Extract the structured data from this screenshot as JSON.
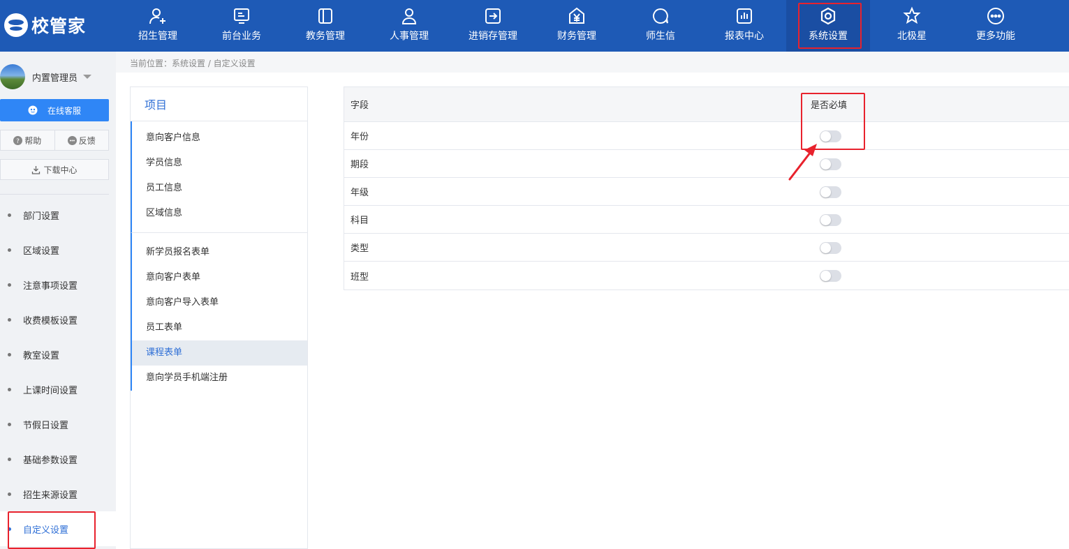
{
  "brand": {
    "logo_text": "校管家"
  },
  "nav": {
    "items": [
      {
        "label": "招生管理",
        "icon": "add-user-icon"
      },
      {
        "label": "前台业务",
        "icon": "monitor-icon"
      },
      {
        "label": "教务管理",
        "icon": "book-icon"
      },
      {
        "label": "人事管理",
        "icon": "person-icon"
      },
      {
        "label": "进销存管理",
        "icon": "exchange-icon"
      },
      {
        "label": "财务管理",
        "icon": "yen-icon"
      },
      {
        "label": "师生信",
        "icon": "chat-icon"
      },
      {
        "label": "报表中心",
        "icon": "report-icon"
      },
      {
        "label": "系统设置",
        "icon": "gear-icon"
      },
      {
        "label": "北极星",
        "icon": "star-icon"
      },
      {
        "label": "更多功能",
        "icon": "more-icon"
      }
    ],
    "active": "系统设置"
  },
  "user": {
    "name": "内置管理员"
  },
  "sidebar": {
    "online_service": "在线客服",
    "help": "帮助",
    "feedback": "反馈",
    "download_center": "下载中心",
    "menu": [
      "部门设置",
      "区域设置",
      "注意事项设置",
      "收费模板设置",
      "教室设置",
      "上课时间设置",
      "节假日设置",
      "基础参数设置",
      "招生来源设置",
      "自定义设置"
    ],
    "active_menu": "自定义设置"
  },
  "breadcrumb": "当前位置：系统设置 / 自定义设置",
  "project_panel": {
    "title": "项目",
    "group1": [
      "意向客户信息",
      "学员信息",
      "员工信息",
      "区域信息"
    ],
    "group2": [
      "新学员报名表单",
      "意向客户表单",
      "意向客户导入表单",
      "员工表单",
      "课程表单",
      "意向学员手机端注册"
    ],
    "active": "课程表单"
  },
  "field_table": {
    "columns": {
      "field": "字段",
      "required": "是否必填"
    },
    "rows": [
      {
        "field": "年份",
        "required": false
      },
      {
        "field": "期段",
        "required": false
      },
      {
        "field": "年级",
        "required": false
      },
      {
        "field": "科目",
        "required": false
      },
      {
        "field": "类型",
        "required": false
      },
      {
        "field": "班型",
        "required": false
      }
    ]
  },
  "colors": {
    "nav_bg": "#1e5ab6",
    "accent": "#2f86f6",
    "highlight_red": "#e8222d",
    "toggle_off": "#dcdfe6"
  }
}
